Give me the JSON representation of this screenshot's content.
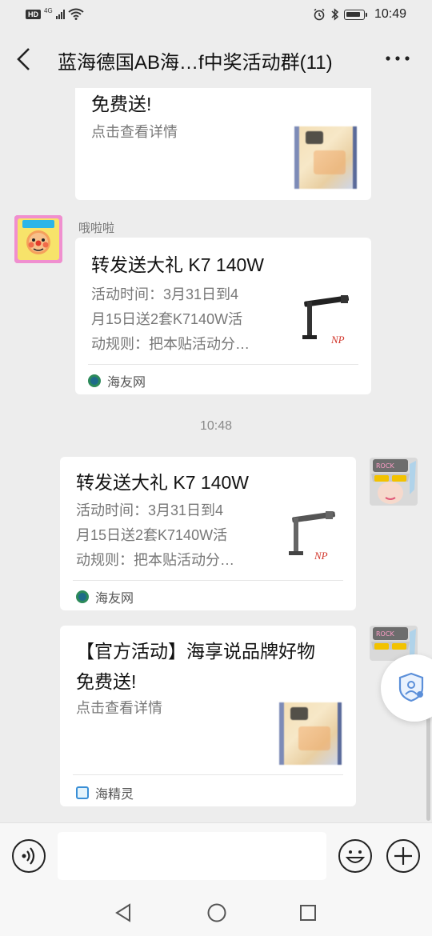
{
  "status_bar": {
    "hd": "HD",
    "network": "4G",
    "time": "10:49"
  },
  "header": {
    "title": "蓝海德国AB海…f中奖活动群(11)"
  },
  "messages": [
    {
      "title": "免费送!",
      "desc": "点击查看详情"
    },
    {
      "sender": "哦啦啦",
      "title": "转发送大礼 K7 140W",
      "desc": [
        "活动时间：3月31日到4",
        "月15日送2套K7140W活",
        "动规则：把本贴活动分…"
      ],
      "source": "海友网",
      "brand": "NP"
    },
    {
      "title": "转发送大礼 K7 140W",
      "desc": [
        "活动时间：3月31日到4",
        "月15日送2套K7140W活",
        "动规则：把本贴活动分…"
      ],
      "source": "海友网",
      "brand": "NP"
    },
    {
      "title": [
        "【官方活动】海享说品牌好物",
        "免费送!"
      ],
      "desc": "点击查看详情",
      "source": "海精灵"
    }
  ],
  "timestamp": "10:48",
  "colors": {
    "background": "#ededed",
    "card": "#ffffff",
    "source_green": "#1e8a5a",
    "source_blue": "#3a8fd6"
  }
}
